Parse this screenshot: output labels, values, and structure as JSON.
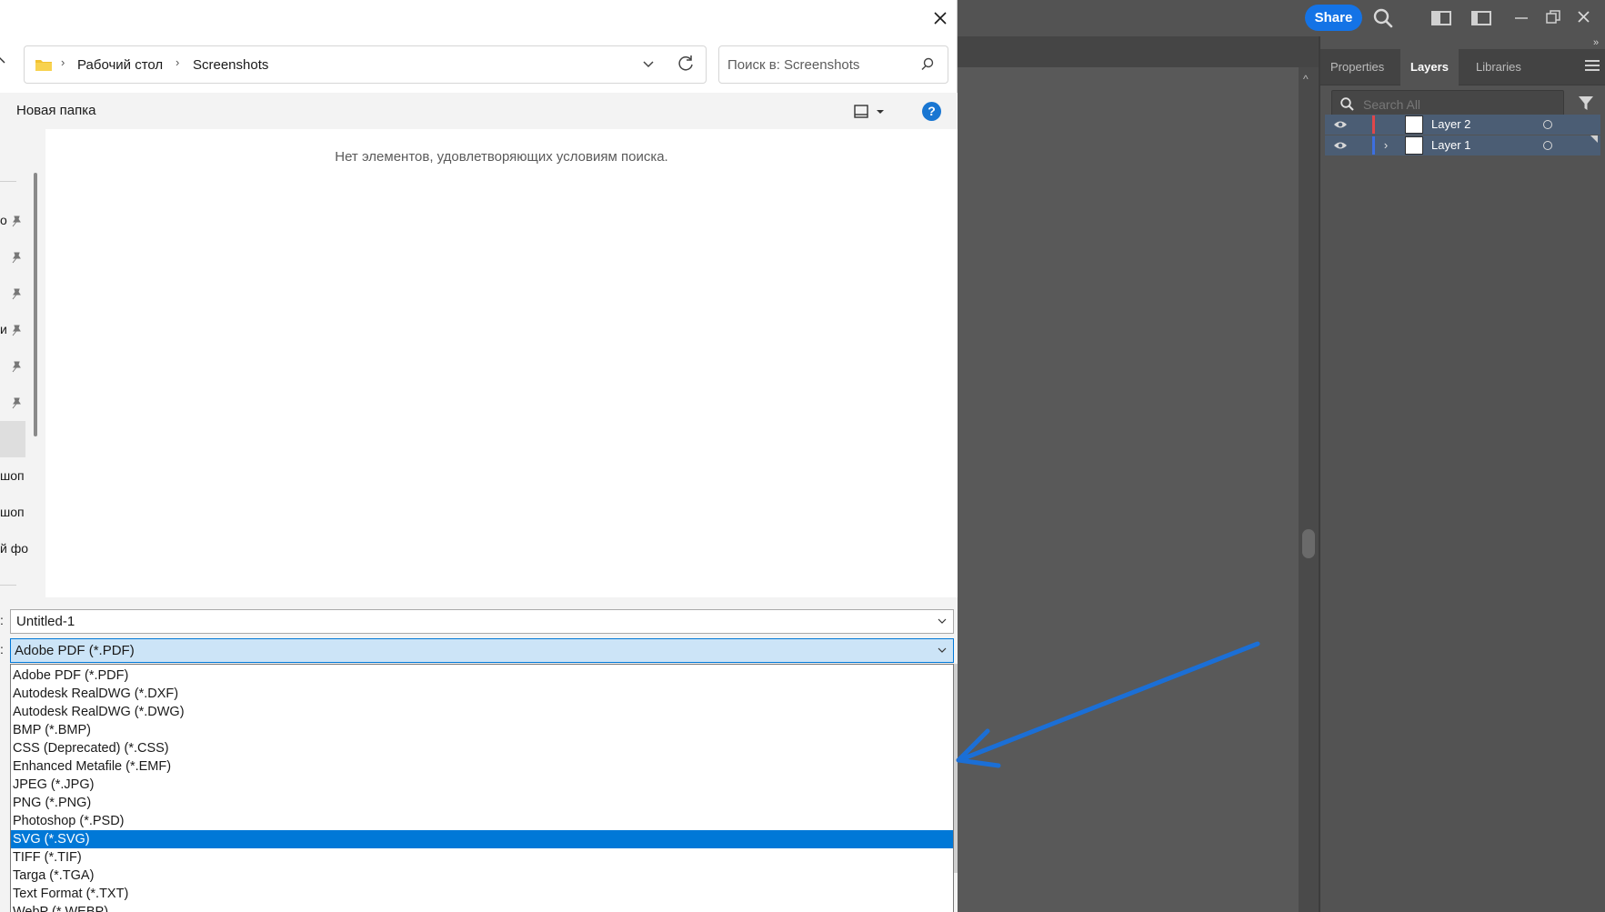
{
  "dialog": {
    "breadcrumb": [
      "Рабочий стол",
      "Screenshots"
    ],
    "search_placeholder": "Поиск в: Screenshots",
    "new_folder": "Новая папка",
    "help_glyph": "?",
    "empty_message": "Нет элементов, удовлетворяющих условиям поиска.",
    "nav_partial": [
      "о",
      "и",
      "шоп",
      "шоп",
      "й фо"
    ],
    "filename_label_cut": ":",
    "type_label_cut": ":",
    "filename": "Untitled-1",
    "filetype": "Adobe PDF (*.PDF)",
    "filetype_options": [
      "Adobe PDF (*.PDF)",
      "Autodesk RealDWG (*.DXF)",
      "Autodesk RealDWG (*.DWG)",
      "BMP (*.BMP)",
      "CSS (Deprecated) (*.CSS)",
      "Enhanced Metafile (*.EMF)",
      "JPEG (*.JPG)",
      "PNG (*.PNG)",
      "Photoshop (*.PSD)",
      "SVG (*.SVG)",
      "TIFF (*.TIF)",
      "Targa (*.TGA)",
      "Text Format (*.TXT)",
      "WebP (*.WEBP)"
    ],
    "selected_option": "SVG (*.SVG)"
  },
  "illustrator": {
    "share": "Share",
    "tabs": [
      "Properties",
      "Layers",
      "Libraries"
    ],
    "active_tab": "Layers",
    "layer_search_placeholder": "Search All",
    "layers": [
      {
        "name": "Layer 2",
        "color": "#e0474a",
        "expandable": false
      },
      {
        "name": "Layer 1",
        "color": "#3d6fe0",
        "expandable": true
      }
    ]
  },
  "icons": [
    "close-icon",
    "folder-icon",
    "chevron-down-icon",
    "refresh-icon",
    "search-icon",
    "view-icon",
    "help-icon",
    "pin-icon",
    "eye-icon",
    "filter-icon",
    "panel-menu-icon",
    "workspace-icon",
    "arrange-icon"
  ],
  "colors": {
    "accent": "#0078d7",
    "selection": "#0078d7",
    "share": "#1473e6",
    "annotation_arrow": "#1b6fd6"
  }
}
